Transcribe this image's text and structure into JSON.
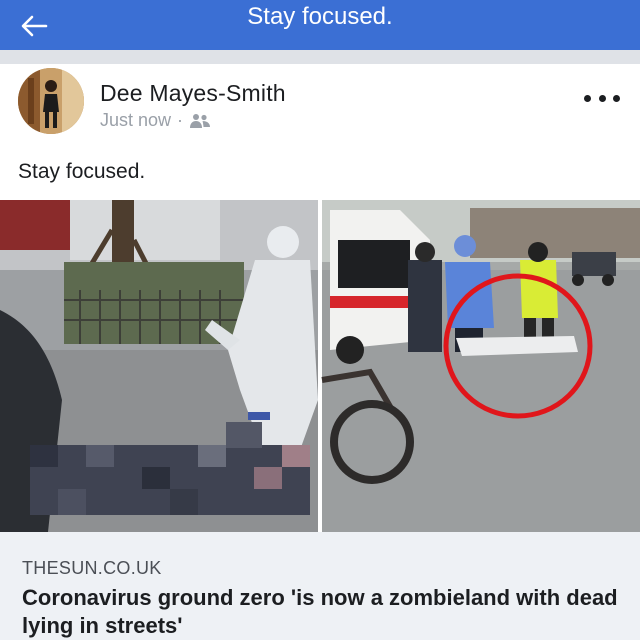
{
  "header": {
    "title": "Stay focused.",
    "back_icon": "arrow-left-icon",
    "background": "#3b6fd4"
  },
  "post": {
    "author": "Dee Mayes-Smith",
    "timestamp": "Just now",
    "separator": "·",
    "audience_icon": "friends-icon",
    "more_icon": "more-options-icon",
    "text": "Stay focused.",
    "media": {
      "left_image": "person-in-hazmat-suit-near-pixelated-body",
      "right_image": "ambulance-and-body-on-street-circled-in-red",
      "highlight_color": "#e0161b"
    },
    "link": {
      "domain": "THESUN.CO.UK",
      "title": "Coronavirus ground zero 'is now a zombieland with dead lying in streets'"
    }
  }
}
